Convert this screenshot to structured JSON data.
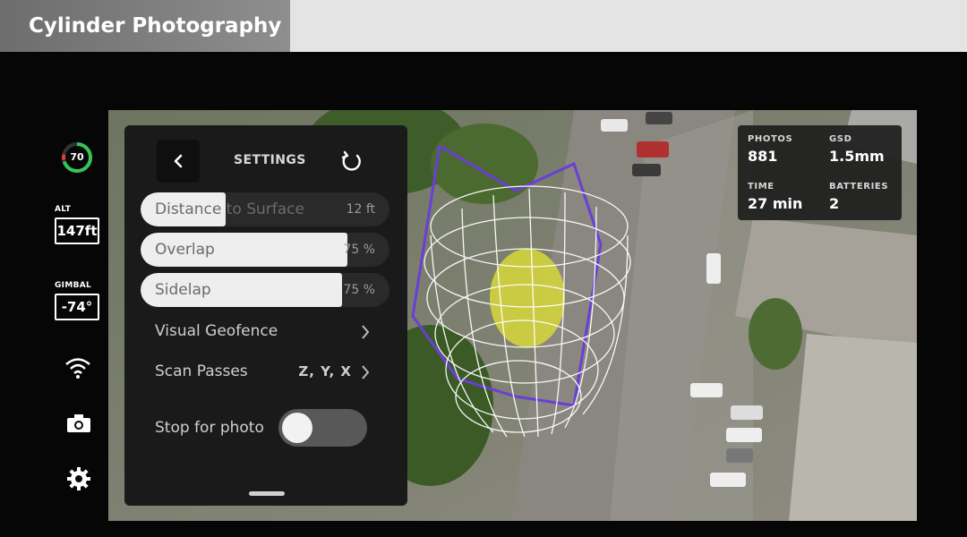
{
  "window": {
    "title": "Cylinder Photography"
  },
  "rail": {
    "battery_percent": "70",
    "battery_level": 0.7,
    "alt_label": "ALT",
    "alt_value": "147ft",
    "gimbal_label": "GIMBAL",
    "gimbal_value": "-74°",
    "icons": [
      "signal-icon",
      "camera-icon",
      "gear-icon"
    ]
  },
  "settings": {
    "title": "SETTINGS",
    "sliders": [
      {
        "label": "Distance to Surface",
        "value": "12 ft",
        "fill_fraction": 0.34
      },
      {
        "label": "Overlap",
        "value": "75 %",
        "fill_fraction": 0.83
      },
      {
        "label": "Sidelap",
        "value": "75 %",
        "fill_fraction": 0.81
      }
    ],
    "visual_geofence": "Visual Geofence",
    "scan_passes": {
      "label": "Scan Passes",
      "value": "Z, Y, X"
    },
    "stop_for_photo": {
      "label": "Stop for photo",
      "on": false
    }
  },
  "stats": {
    "photos_label": "PHOTOS",
    "photos_value": "881",
    "gsd_label": "GSD",
    "gsd_value": "1.5mm",
    "time_label": "TIME",
    "time_value": "27 min",
    "batteries_label": "BATTERIES",
    "batteries_value": "2"
  },
  "colors": {
    "accent_green": "#35c45a",
    "battery_red": "#d9433a",
    "flight_path": "#6a3fd6",
    "scan_mesh": "#ffffff"
  }
}
